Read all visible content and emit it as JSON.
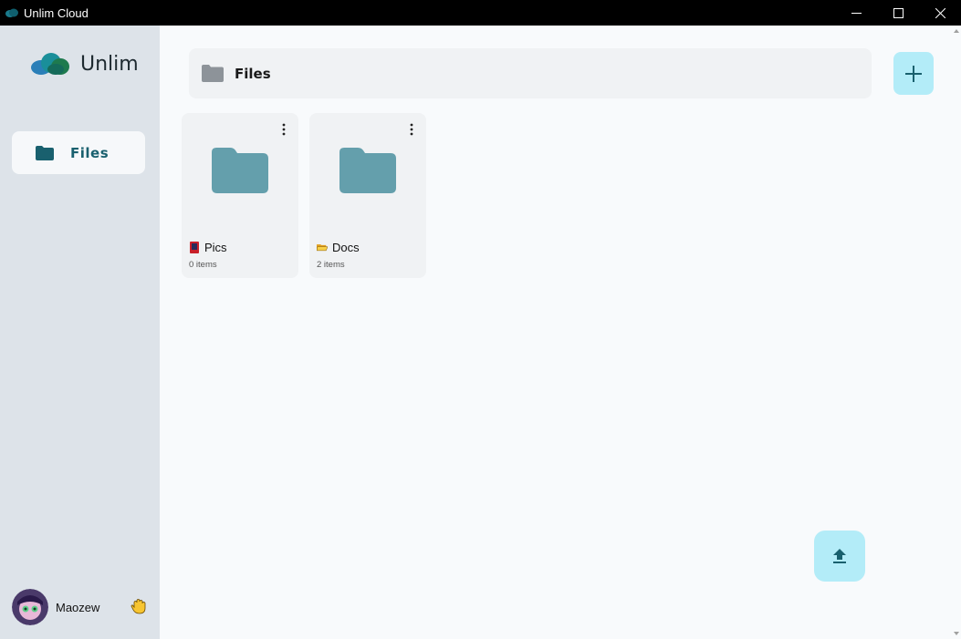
{
  "window": {
    "title": "Unlim Cloud",
    "app_icon": "cloud-icon",
    "controls": [
      "minimize-icon",
      "maximize-icon",
      "close-icon"
    ]
  },
  "sidebar": {
    "brand": {
      "name": "Unlim",
      "logo": "cloud-logo"
    },
    "items": [
      {
        "label": "Files",
        "icon": "folder-icon",
        "active": true
      }
    ],
    "user": {
      "name": "Maozew",
      "avatar": "avatar",
      "badge": "wave-hand-icon"
    }
  },
  "main": {
    "breadcrumb": {
      "label": "Files",
      "icon": "folder-icon"
    },
    "add_button": {
      "icon": "plus-icon"
    },
    "upload_button": {
      "icon": "upload-icon"
    },
    "folders": [
      {
        "name": "Pics",
        "count": "0 items",
        "emoji": "red-card-icon"
      },
      {
        "name": "Docs",
        "count": "2 items",
        "emoji": "open-folder-icon"
      }
    ]
  },
  "colors": {
    "sidebar_bg": "#dde3e9",
    "accent": "#19606e",
    "folder": "#649fac",
    "fab_bg": "#b3ecf8"
  }
}
